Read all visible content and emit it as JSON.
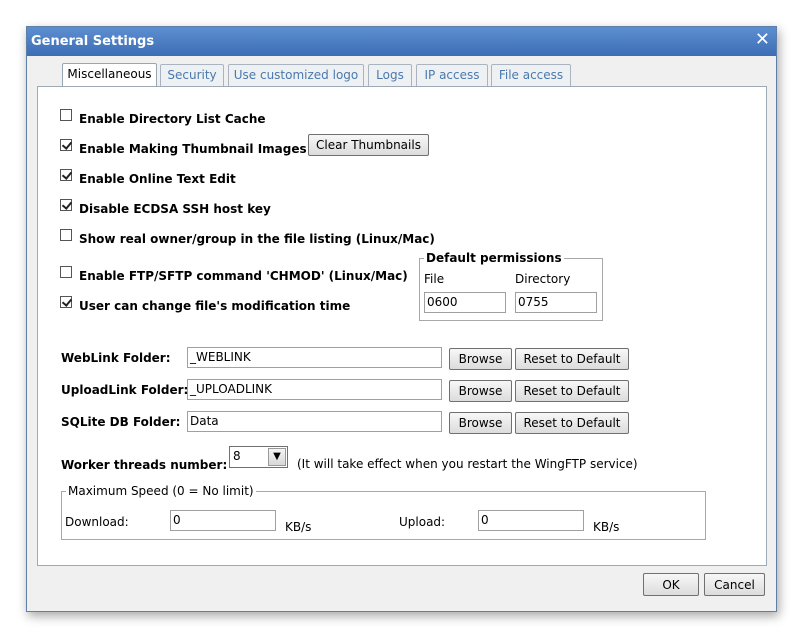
{
  "window": {
    "title": "General Settings",
    "close_glyph": "✕"
  },
  "tabs": [
    {
      "label": "Miscellaneous",
      "active": true
    },
    {
      "label": "Security"
    },
    {
      "label": "Use customized logo"
    },
    {
      "label": "Logs"
    },
    {
      "label": "IP access"
    },
    {
      "label": "File access"
    }
  ],
  "options": {
    "dir_cache": {
      "label": "Enable Directory List Cache",
      "checked": false
    },
    "thumbnails": {
      "label": "Enable Making Thumbnail Images",
      "checked": true
    },
    "text_edit": {
      "label": "Enable Online Text Edit",
      "checked": true
    },
    "ecdsa": {
      "label": "Disable ECDSA SSH host key",
      "checked": true
    },
    "real_owner": {
      "label": "Show real owner/group in the file listing (Linux/Mac)",
      "checked": false
    },
    "chmod": {
      "label": "Enable FTP/SFTP command 'CHMOD' (Linux/Mac)",
      "checked": false
    },
    "mod_time": {
      "label": "User can change file's modification time",
      "checked": true
    }
  },
  "clear_thumbnails_label": "Clear Thumbnails",
  "permissions": {
    "legend": "Default permissions",
    "file_label": "File",
    "dir_label": "Directory",
    "file_value": "0600",
    "dir_value": "0755"
  },
  "folders": {
    "weblink": {
      "label": "WebLink Folder:",
      "value": "_WEBLINK"
    },
    "uploadlink": {
      "label": "UploadLink Folder:",
      "value": "_UPLOADLINK"
    },
    "sqlite": {
      "label": "SQLite DB Folder:",
      "value": "Data"
    },
    "browse_label": "Browse",
    "reset_label": "Reset to Default"
  },
  "workers": {
    "label": "Worker threads number:",
    "value": "8",
    "note": "(It will take effect when you restart the WingFTP service)"
  },
  "speed": {
    "legend": "Maximum Speed (0 = No limit)",
    "download_label": "Download:",
    "download_value": "0",
    "upload_label": "Upload:",
    "upload_value": "0",
    "unit": "KB/s"
  },
  "footer": {
    "ok_label": "OK",
    "cancel_label": "Cancel"
  }
}
